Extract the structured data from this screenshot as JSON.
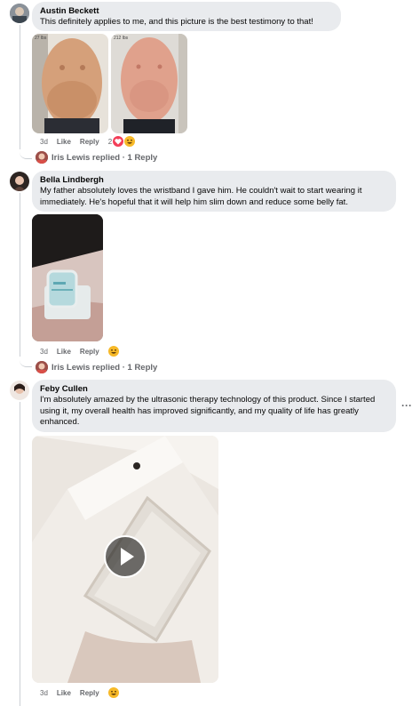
{
  "comments": [
    {
      "author": "Austin Beckett",
      "text": "This definitely applies to me, and this picture is the best testimony to that!",
      "photo_left_label": "27 lbs",
      "photo_right_label": "212 lbs",
      "age": "3d",
      "like": "Like",
      "reply": "Reply",
      "reaction_count": "2",
      "replied_text": "Iris Lewis replied · 1 Reply"
    },
    {
      "author": "Bella Lindbergh",
      "text": "My father absolutely loves the wristband I gave him. He couldn't wait to start wearing it immediately. He's hopeful that it will help him slim down and reduce some belly fat.",
      "age": "3d",
      "like": "Like",
      "reply": "Reply",
      "replied_text": "Iris Lewis replied · 1 Reply"
    },
    {
      "author": "Feby Cullen",
      "text": "I'm absolutely amazed by the ultrasonic therapy technology of this product. Since I started using it, my overall health has improved significantly, and my quality of life has greatly enhanced.",
      "age": "3d",
      "like": "Like",
      "reply": "Reply",
      "more_menu": "···"
    }
  ],
  "colors": {
    "bubble": "#e9ebee",
    "meta_text": "#65676b",
    "reaction_heart": "#f33e58",
    "reaction_haha": "#f7b928"
  },
  "icons": [
    "heart-reaction-icon",
    "haha-reaction-icon",
    "play-icon",
    "more-icon"
  ]
}
